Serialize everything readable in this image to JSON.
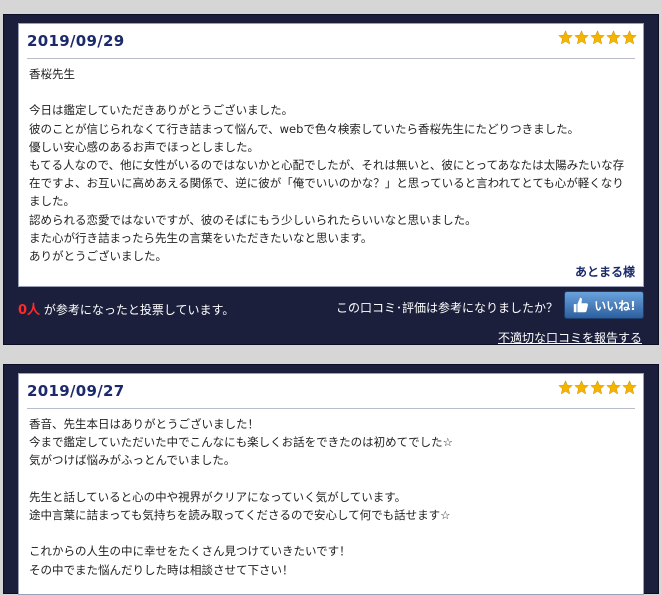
{
  "reviews": [
    {
      "date": "2019/09/29",
      "body": "香桜先生\n\n今日は鑑定していただきありがとうございました。\n彼のことが信じられなくて行き詰まって悩んで、webで色々検索していたら香桜先生にたどりつきました。\n優しい安心感のあるお声でほっとしました。\nもてる人なので、他に女性がいるのではないかと心配でしたが、それは無いと、彼にとってあなたは太陽みたいな存在ですよ、お互いに高めあえる関係で、逆に彼が「俺でいいのかな？」と思っていると言われてとても心が軽くなりました。\n認められる恋愛ではないですが、彼のそばにもう少しいられたらいいなと思いました。\nまた心が行き詰まったら先生の言葉をいただきたいなと思います。\nありがとうございました。",
      "reviewer": "あとまる様",
      "helpful_count": "0人",
      "helpful_text": "が参考になったと投票しています。",
      "helpful_question": "この口コミ･評価は参考になりましたか？",
      "like_label": "いいね!",
      "report_label": "不適切な口コミを報告する"
    },
    {
      "date": "2019/09/27",
      "body": "香音、先生本日はありがとうございました！\n今まで鑑定していただいた中でこんなにも楽しくお話をできたのは初めてでした☆\n気がつけば悩みがふっとんでいました。\n\n先生と話していると心の中や視界がクリアになっていく気がしています。\n途中言葉に詰まっても気持ちを読み取ってくださるので安心して何でも話せます☆\n\nこれからの人生の中に幸せをたくさん見つけていきたいです！\nその中でまた悩んだりした時は相談させて下さい！"
    }
  ],
  "rating": 5,
  "colors": {
    "star": "#f5b400",
    "card_bg": "#1b1f3b",
    "date": "#1b2a6b",
    "helpful_count": "#ff2a2a"
  }
}
